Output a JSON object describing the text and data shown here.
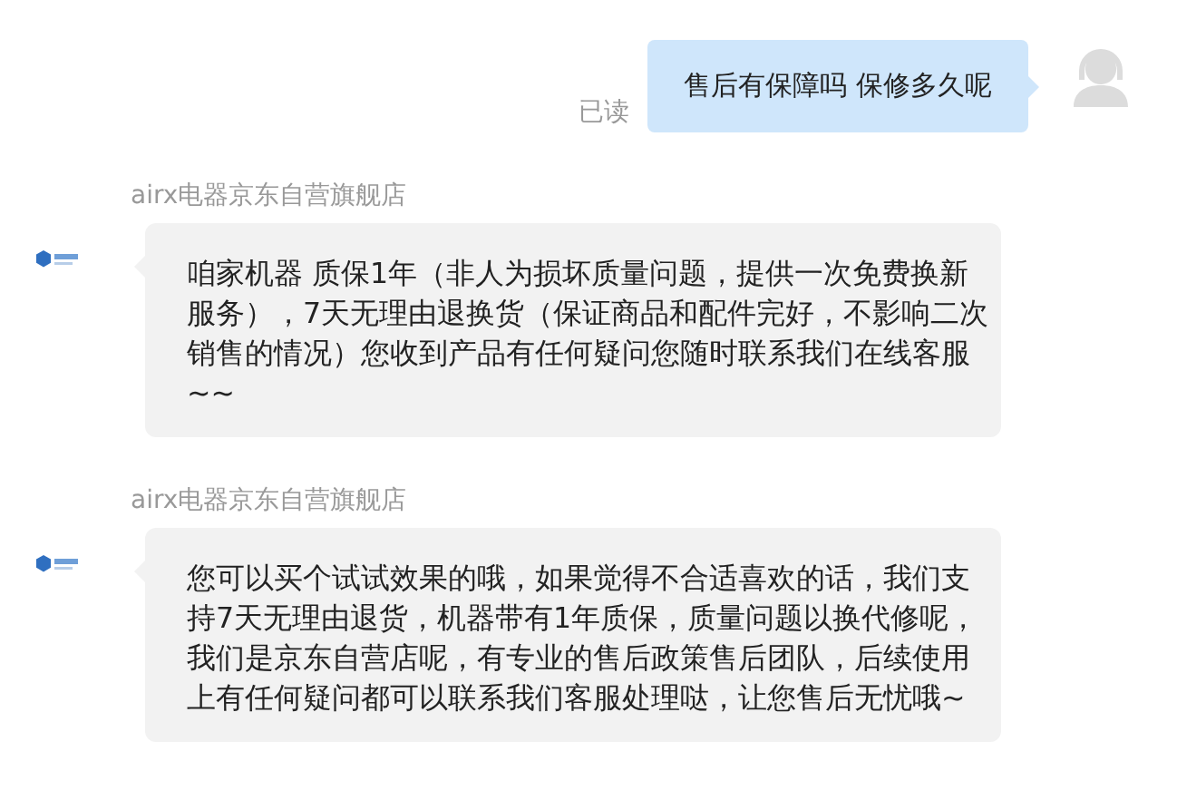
{
  "messages": [
    {
      "kind": "outgoing",
      "text": "售后有保障吗 保修多久呢",
      "status": "已读"
    },
    {
      "kind": "incoming",
      "sender": "airx电器京东自营旗舰店",
      "text": "咱家机器 质保1年（非人为损坏质量问题，提供一次免费换新服务），7天无理由退换货（保证商品和配件完好，不影响二次销售的情况）您收到产品有任何疑问您随时联系我们在线客服~~"
    },
    {
      "kind": "incoming",
      "sender": "airx电器京东自营旗舰店",
      "text": "您可以买个试试效果的哦，如果觉得不合适喜欢的话，我们支持7天无理由退货，机器带有1年质保，质量问题以换代修呢，我们是京东自营店呢，有专业的售后政策售后团队，后续使用上有任何疑问都可以联系我们客服处理哒，让您售后无忧哦~"
    }
  ]
}
